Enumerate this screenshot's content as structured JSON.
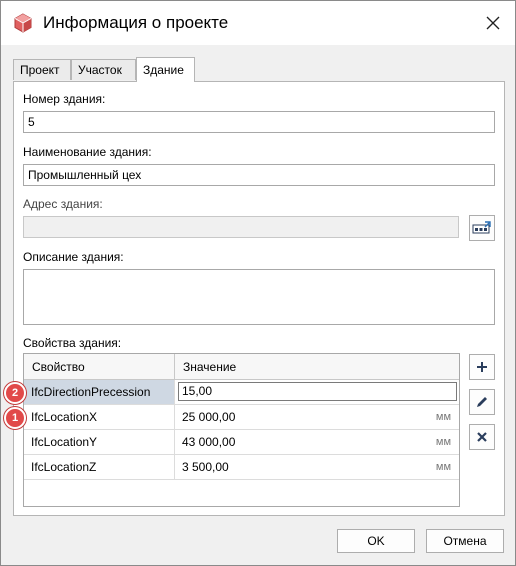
{
  "window": {
    "title": "Информация о проекте"
  },
  "tabs": [
    {
      "label": "Проект"
    },
    {
      "label": "Участок"
    },
    {
      "label": "Здание"
    }
  ],
  "form": {
    "building_number_label": "Номер здания:",
    "building_number_value": "5",
    "building_name_label": "Наименование здания:",
    "building_name_value": "Промышленный цех",
    "address_label": "Адрес здания:",
    "address_value": "",
    "description_label": "Описание здания:",
    "description_value": "",
    "properties_label": "Свойства здания:"
  },
  "grid": {
    "col_property": "Свойство",
    "col_value": "Значение",
    "rows": [
      {
        "property": "IfcDirectionPrecession",
        "value": "15,00",
        "unit": ""
      },
      {
        "property": "IfcLocationX",
        "value": "25 000,00",
        "unit": "мм"
      },
      {
        "property": "IfcLocationY",
        "value": "43 000,00",
        "unit": "мм"
      },
      {
        "property": "IfcLocationZ",
        "value": "3 500,00",
        "unit": "мм"
      }
    ]
  },
  "badges": [
    "2",
    "1"
  ],
  "buttons": {
    "ok": "OK",
    "cancel": "Отмена"
  },
  "colors": {
    "badge": "#e14a4a",
    "selection": "#cfd8e3",
    "accent": "#2a6fb5"
  },
  "icons": [
    "app-logo-icon",
    "close-icon",
    "address-picker-icon",
    "add-icon",
    "edit-icon",
    "delete-icon"
  ]
}
